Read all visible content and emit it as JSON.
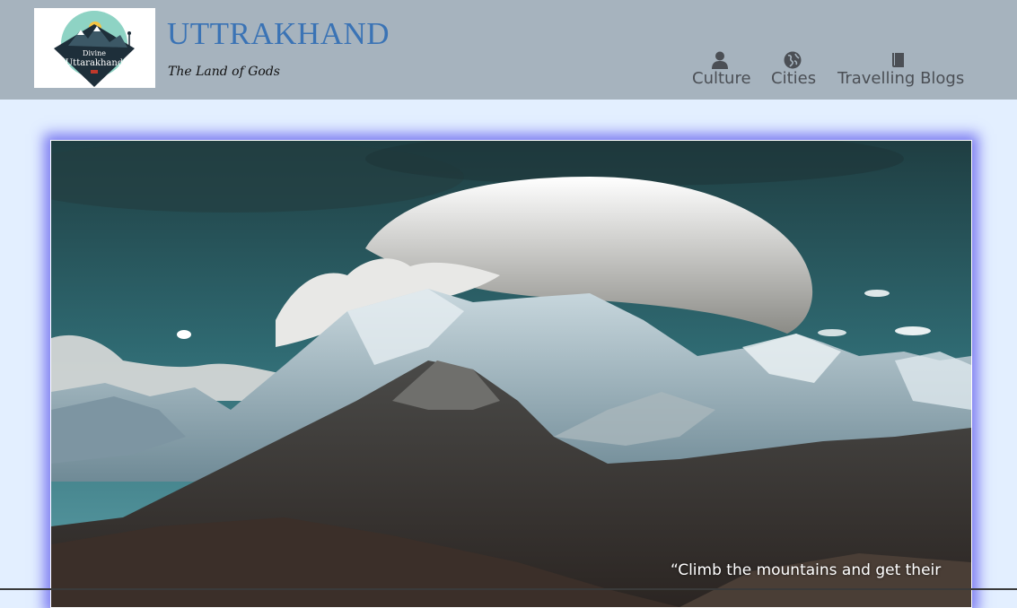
{
  "header": {
    "logo": {
      "line1": "Divine",
      "line2": "Uttarakhand"
    },
    "title": "UTTRAKHAND",
    "tagline": "The Land of Gods"
  },
  "nav": {
    "items": [
      {
        "label": "Culture",
        "icon": "person-icon"
      },
      {
        "label": "Cities",
        "icon": "globe-icon"
      },
      {
        "label": "Travelling Blogs",
        "icon": "book-icon"
      }
    ]
  },
  "hero": {
    "quote": "“Climb the mountains and get their"
  },
  "colors": {
    "header_bg": "#a6b3be",
    "page_bg": "#e3efff",
    "title": "#3a73b5",
    "nav_text": "#4b4f55",
    "hero_glow": "#7d7df2"
  }
}
